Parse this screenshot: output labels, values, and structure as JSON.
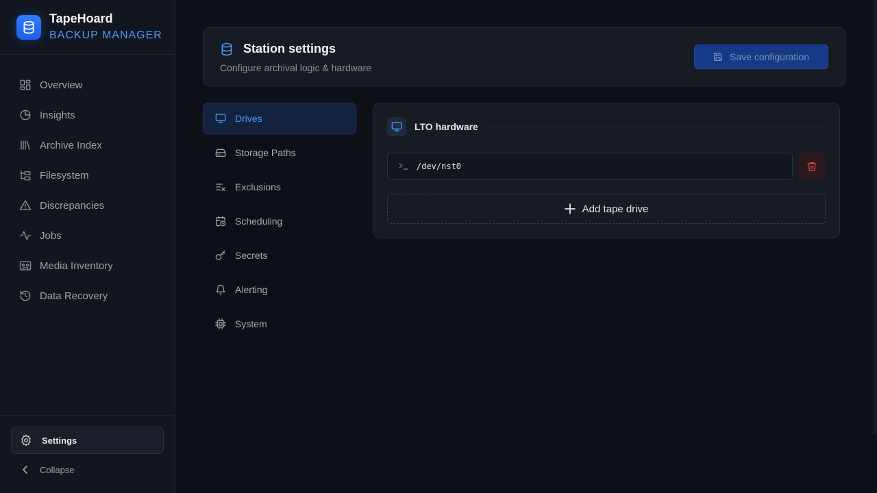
{
  "app": {
    "name": "TapeHoard",
    "subtitle": "BACKUP MANAGER"
  },
  "sidebar": {
    "items": [
      {
        "label": "Overview",
        "icon": "grid-icon"
      },
      {
        "label": "Insights",
        "icon": "pie-chart-icon"
      },
      {
        "label": "Archive Index",
        "icon": "library-icon"
      },
      {
        "label": "Filesystem",
        "icon": "folder-tree-icon"
      },
      {
        "label": "Discrepancies",
        "icon": "warning-triangle-icon"
      },
      {
        "label": "Jobs",
        "icon": "activity-icon"
      },
      {
        "label": "Media Inventory",
        "icon": "cassette-icon"
      },
      {
        "label": "Data Recovery",
        "icon": "history-icon"
      }
    ],
    "settings_label": "Settings",
    "collapse_label": "Collapse"
  },
  "header": {
    "title": "Station settings",
    "description": "Configure archival logic & hardware",
    "save_label": "Save configuration"
  },
  "tabs": [
    {
      "label": "Drives",
      "icon": "monitor-icon",
      "active": true
    },
    {
      "label": "Storage Paths",
      "icon": "hard-drive-icon"
    },
    {
      "label": "Exclusions",
      "icon": "list-x-icon"
    },
    {
      "label": "Scheduling",
      "icon": "calendar-clock-icon"
    },
    {
      "label": "Secrets",
      "icon": "key-icon"
    },
    {
      "label": "Alerting",
      "icon": "bell-icon"
    },
    {
      "label": "System",
      "icon": "cpu-icon"
    }
  ],
  "drives_panel": {
    "title": "LTO hardware",
    "drives": [
      {
        "path": "/dev/nst0"
      }
    ],
    "add_label": "Add tape drive"
  },
  "colors": {
    "accent": "#4e9bff",
    "danger": "#e0443f",
    "background": "#0d1017"
  }
}
